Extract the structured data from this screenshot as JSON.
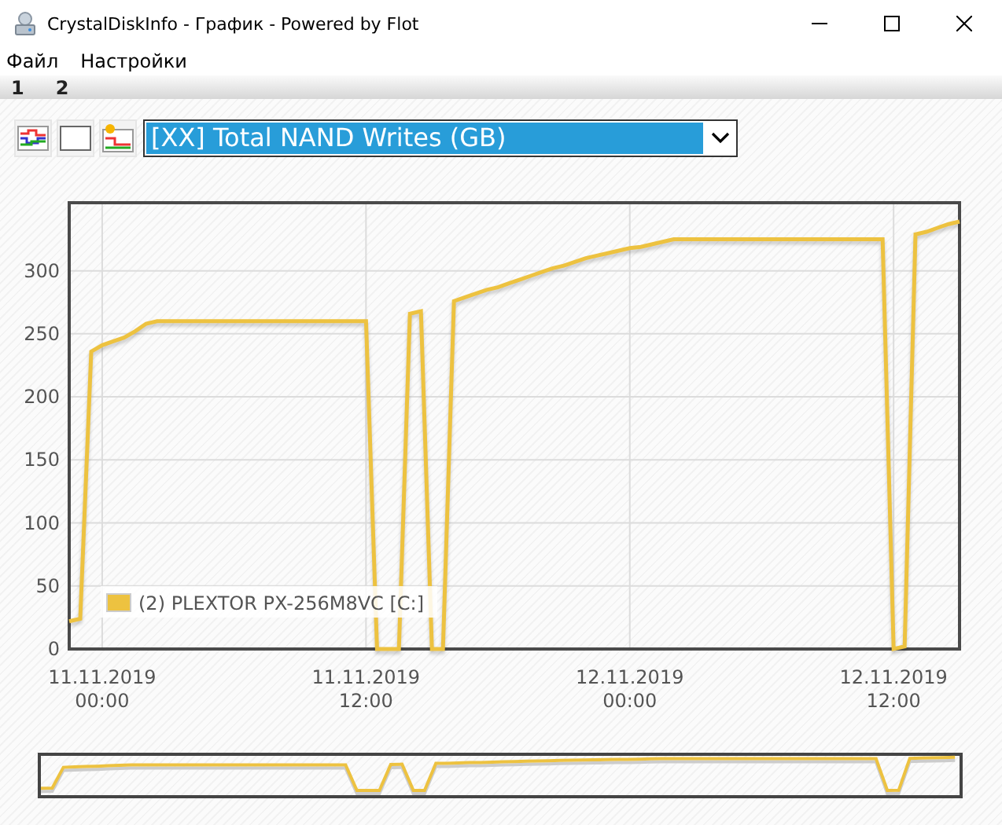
{
  "window": {
    "title": "CrystalDiskInfo - График - Powered by Flot"
  },
  "menu": [
    "Файл",
    "Настройки"
  ],
  "tabs": [
    "1",
    "2"
  ],
  "toolbar": {
    "attribute_select": {
      "value": "[XX] Total NAND Writes (GB)"
    }
  },
  "chart": {
    "chart_data": {
      "type": "line",
      "categories": [
        null,
        null,
        null,
        "11.11.2019 00:00",
        null,
        null,
        null,
        null,
        null,
        null,
        null,
        null,
        null,
        null,
        null,
        null,
        null,
        null,
        null,
        null,
        null,
        null,
        null,
        null,
        null,
        null,
        null,
        "11.11.2019 12:00",
        null,
        null,
        null,
        null,
        null,
        null,
        null,
        null,
        null,
        null,
        null,
        null,
        null,
        null,
        null,
        null,
        null,
        null,
        null,
        null,
        null,
        null,
        null,
        "12.11.2019 00:00",
        null,
        null,
        null,
        null,
        null,
        null,
        null,
        null,
        null,
        null,
        null,
        null,
        null,
        null,
        null,
        null,
        null,
        null,
        null,
        null,
        null,
        null,
        null,
        "12.11.2019 12:00",
        null,
        null,
        null,
        null,
        null,
        null
      ],
      "series": [
        {
          "name": "(2) PLEXTOR PX-256M8VC [C:]",
          "color": "#edc240",
          "values": [
            22,
            24,
            236,
            241,
            244,
            247,
            252,
            258,
            260,
            260,
            260,
            260,
            260,
            260,
            260,
            260,
            260,
            260,
            260,
            260,
            260,
            260,
            260,
            260,
            260,
            260,
            260,
            260,
            0,
            0,
            0,
            266,
            268,
            0,
            0,
            276,
            279,
            282,
            285,
            287,
            290,
            293,
            296,
            299,
            302,
            304,
            307,
            310,
            312,
            314,
            316,
            318,
            319,
            321,
            323,
            325,
            325,
            325,
            325,
            325,
            325,
            325,
            325,
            325,
            325,
            325,
            325,
            325,
            325,
            325,
            325,
            325,
            325,
            325,
            325,
            0,
            2,
            329,
            331,
            334,
            337,
            339
          ]
        }
      ],
      "grid": true,
      "ylim": [
        0,
        354
      ],
      "yticks": [
        0,
        50,
        100,
        150,
        200,
        250,
        300
      ]
    }
  }
}
